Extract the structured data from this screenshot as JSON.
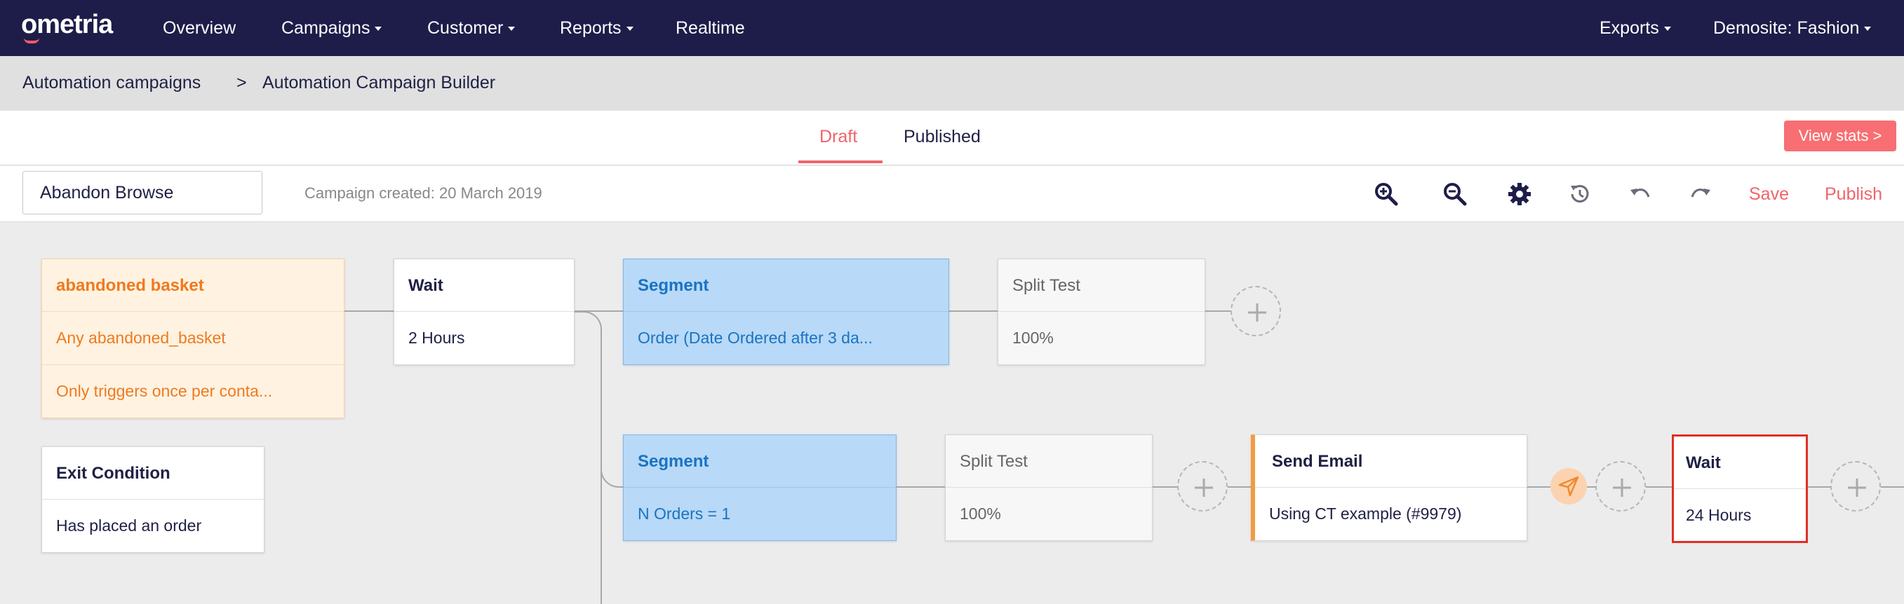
{
  "app": {
    "logo": "ometria",
    "nav": [
      "Overview",
      "Campaigns",
      "Customer",
      "Reports",
      "Realtime"
    ],
    "nav_right": [
      "Exports",
      "Demosite: Fashion"
    ]
  },
  "breadcrumb": {
    "items": [
      "Automation campaigns",
      "Automation Campaign Builder"
    ],
    "separator": ">"
  },
  "tabs": {
    "items": [
      "Draft",
      "Published"
    ],
    "active": "Draft",
    "view_stats": "View stats >"
  },
  "toolbar": {
    "campaign_name": "Abandon Browse",
    "created": "Campaign created: 20 March 2019",
    "icons": [
      "zoom-in-icon",
      "zoom-out-icon",
      "gear-icon",
      "history-icon",
      "undo-icon",
      "redo-icon"
    ],
    "save": "Save",
    "publish": "Publish"
  },
  "flow": {
    "trigger": {
      "title": "abandoned basket",
      "rows": [
        "Any abandoned_basket",
        "Only triggers once per conta..."
      ]
    },
    "exit": {
      "title": "Exit Condition",
      "value": "Has placed an order"
    },
    "wait1": {
      "title": "Wait",
      "value": "2 Hours"
    },
    "segment1": {
      "title": "Segment",
      "value": "Order (Date Ordered after 3 da..."
    },
    "split1": {
      "title": "Split Test",
      "value": "100%"
    },
    "segment2": {
      "title": "Segment",
      "value": "N Orders = 1"
    },
    "split2": {
      "title": "Split Test",
      "value": "100%"
    },
    "email": {
      "title": "Send Email",
      "value": "Using CT example (#9979)"
    },
    "wait2": {
      "title": "Wait",
      "value": "24 Hours"
    }
  },
  "colors": {
    "nav_bg": "#1e1d4a",
    "accent": "#f0646a",
    "trigger": "#ee7a1f",
    "segment": "#1a73c2",
    "selected": "#e02e24"
  }
}
